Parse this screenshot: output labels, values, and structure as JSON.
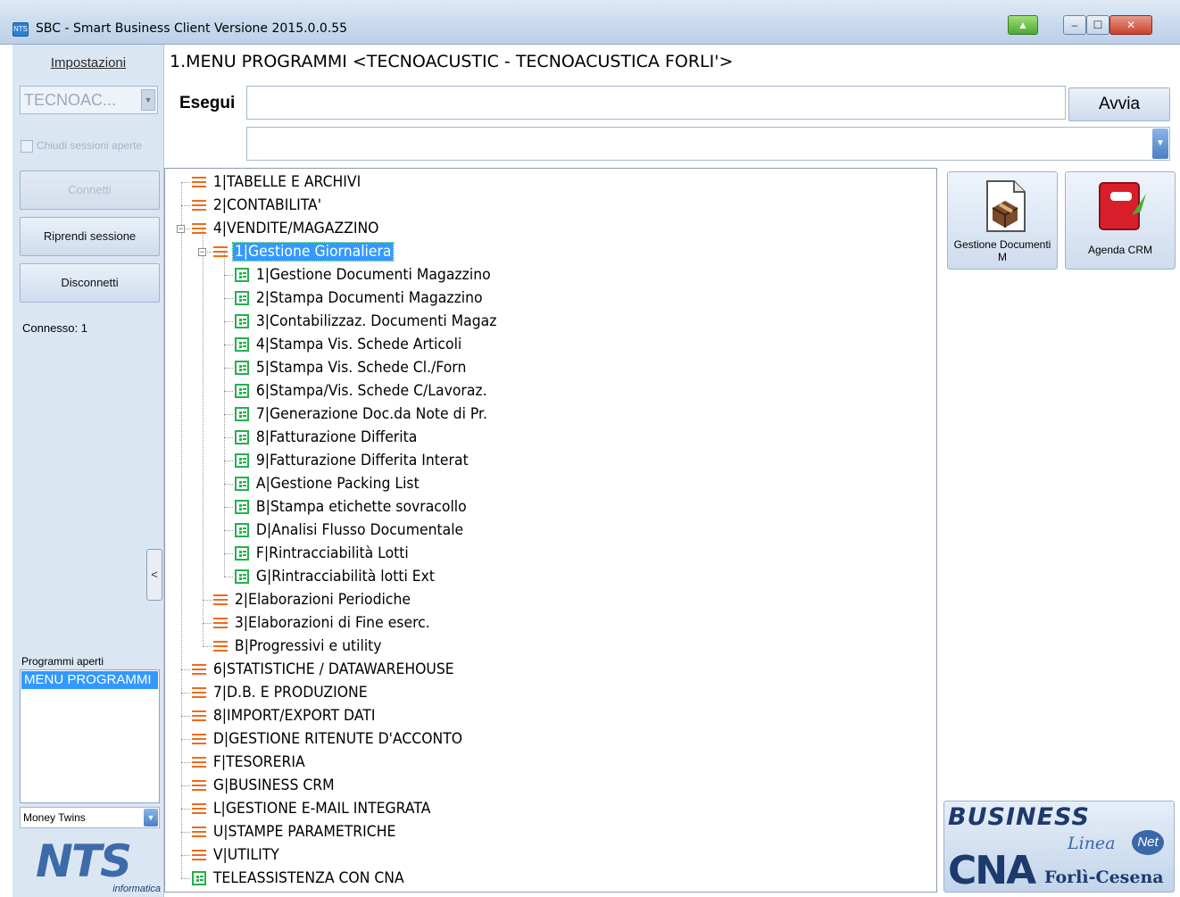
{
  "window": {
    "title": "SBC - Smart Business Client  Versione 2015.0.0.55",
    "min_symbol": "–",
    "max_symbol": "☐",
    "close_symbol": "✕",
    "extra_symbol": "▲"
  },
  "sidebar": {
    "settings_label": "Impostazioni",
    "company_value": "TECNOAC...",
    "dropdown_arrow": "▼",
    "close_sessions_label": "Chiudi sessioni aperte",
    "connect_label": "Connetti",
    "resume_label": "Riprendi sessione",
    "disconnect_label": "Disconnetti",
    "connected_text": "Connesso: 1",
    "collapse_symbol": "<",
    "open_programs_label": "Programmi aperti",
    "open_programs": [
      "MENU PROGRAMMI"
    ],
    "model_value": "Money Twins",
    "logo_big": "NTS",
    "logo_small": "informatica"
  },
  "header": {
    "title": "1.MENU PROGRAMMI <TECNOACUSTIC - TECNOACUSTICA FORLI'>",
    "run_label": "Esegui",
    "run_value": "",
    "start_button": "Avvia",
    "secondary_value": ""
  },
  "tree": [
    {
      "label": "1|TABELLE E ARCHIVI",
      "type": "menu",
      "level": 0
    },
    {
      "label": "2|CONTABILITA'",
      "type": "menu",
      "level": 0
    },
    {
      "label": "4|VENDITE/MAGAZZINO",
      "type": "menu",
      "level": 0,
      "expanded": true
    },
    {
      "label": "1|Gestione Giornaliera",
      "type": "menu",
      "level": 1,
      "expanded": true,
      "selected": true
    },
    {
      "label": "1|Gestione Documenti Magazzino",
      "type": "program",
      "level": 2
    },
    {
      "label": "2|Stampa Documenti Magazzino",
      "type": "program",
      "level": 2
    },
    {
      "label": "3|Contabilizzaz. Documenti Magaz",
      "type": "program",
      "level": 2
    },
    {
      "label": "4|Stampa Vis. Schede Articoli",
      "type": "program",
      "level": 2
    },
    {
      "label": "5|Stampa Vis. Schede Cl./Forn",
      "type": "program",
      "level": 2
    },
    {
      "label": "6|Stampa/Vis. Schede C/Lavoraz.",
      "type": "program",
      "level": 2
    },
    {
      "label": "7|Generazione Doc.da Note di Pr.",
      "type": "program",
      "level": 2
    },
    {
      "label": "8|Fatturazione Differita",
      "type": "program",
      "level": 2
    },
    {
      "label": "9|Fatturazione Differita Interat",
      "type": "program",
      "level": 2
    },
    {
      "label": "A|Gestione Packing List",
      "type": "program",
      "level": 2
    },
    {
      "label": "B|Stampa etichette sovracollo",
      "type": "program",
      "level": 2
    },
    {
      "label": "D|Analisi Flusso Documentale",
      "type": "program",
      "level": 2
    },
    {
      "label": "F|Rintracciabilità Lotti",
      "type": "program",
      "level": 2
    },
    {
      "label": "G|Rintracciabilità lotti Ext",
      "type": "program",
      "level": 2
    },
    {
      "label": "2|Elaborazioni Periodiche",
      "type": "menu",
      "level": 1
    },
    {
      "label": "3|Elaborazioni di Fine eserc.",
      "type": "menu",
      "level": 1
    },
    {
      "label": "B|Progressivi e utility",
      "type": "menu",
      "level": 1
    },
    {
      "label": "6|STATISTICHE / DATAWAREHOUSE",
      "type": "menu",
      "level": 0
    },
    {
      "label": "7|D.B. E PRODUZIONE",
      "type": "menu",
      "level": 0
    },
    {
      "label": "8|IMPORT/EXPORT DATI",
      "type": "menu",
      "level": 0
    },
    {
      "label": "D|GESTIONE RITENUTE D'ACCONTO",
      "type": "menu",
      "level": 0
    },
    {
      "label": "F|TESORERIA",
      "type": "menu",
      "level": 0
    },
    {
      "label": "G|BUSINESS CRM",
      "type": "menu",
      "level": 0
    },
    {
      "label": "L|GESTIONE E-MAIL INTEGRATA",
      "type": "menu",
      "level": 0
    },
    {
      "label": "U|STAMPE PARAMETRICHE",
      "type": "menu",
      "level": 0
    },
    {
      "label": "V|UTILITY",
      "type": "menu",
      "level": 0
    },
    {
      "label": "TELEASSISTENZA CON CNA",
      "type": "program",
      "level": 0
    }
  ],
  "tiles": {
    "documents_label": "Gestione Documenti M",
    "crm_label": "Agenda CRM"
  },
  "cna_logo": {
    "business": "BUSINESS",
    "linea": "Linea",
    "net": "Net",
    "cna": "CNA",
    "city": "Forlì-Cesena"
  },
  "colors": {
    "selection": "#3399ff",
    "menu_icon": "#f06a1a",
    "program_icon": "#22b14c",
    "panel_bg": "#dbe6f3"
  }
}
